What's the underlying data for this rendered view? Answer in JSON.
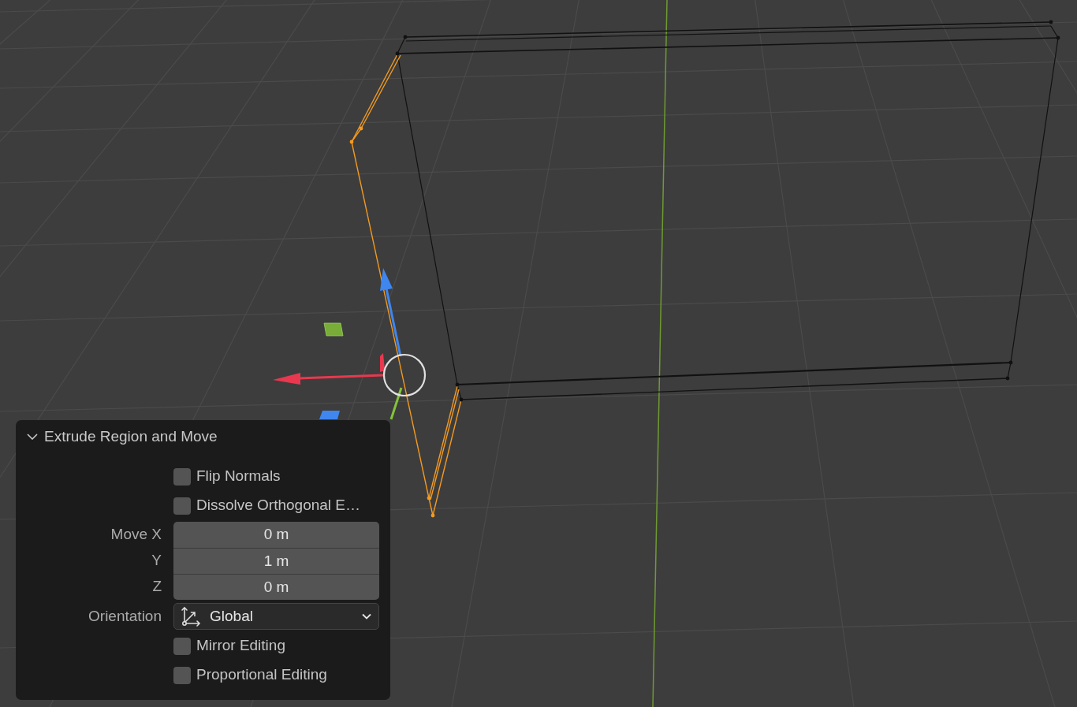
{
  "panel": {
    "title": "Extrude Region and Move",
    "expanded": true,
    "rows": [
      {
        "kind": "checkbox",
        "label": "Flip Normals",
        "checked": false
      },
      {
        "kind": "checkbox",
        "label": "Dissolve Orthogonal E…",
        "checked": false
      },
      {
        "kind": "number",
        "label": "Move X",
        "value": "0 m"
      },
      {
        "kind": "number",
        "label": "Y",
        "value": "1 m"
      },
      {
        "kind": "number",
        "label": "Z",
        "value": "0 m"
      },
      {
        "kind": "dropdown",
        "label": "Orientation",
        "value": "Global"
      },
      {
        "kind": "checkbox",
        "label": "Mirror Editing",
        "checked": false
      },
      {
        "kind": "checkbox",
        "label": "Proportional Editing",
        "checked": false
      }
    ]
  }
}
